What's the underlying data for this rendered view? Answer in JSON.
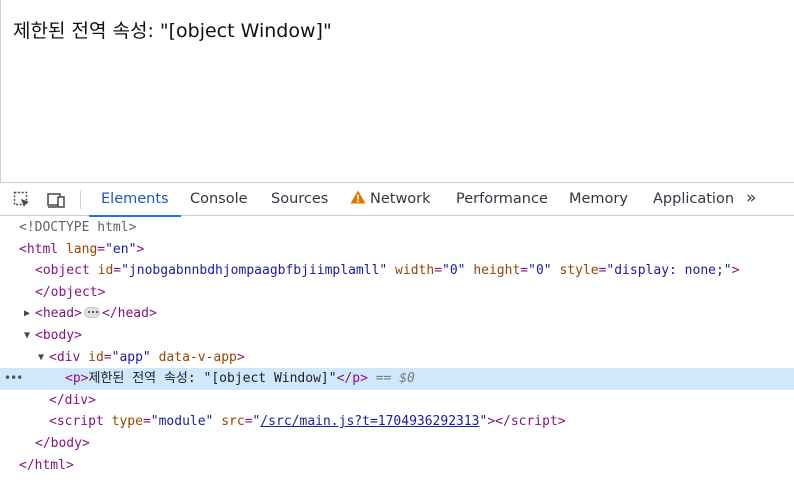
{
  "page": {
    "text": "제한된 전역 속성: \"[object Window]\""
  },
  "devtools": {
    "tabs": [
      {
        "label": "Elements",
        "active": true
      },
      {
        "label": "Console"
      },
      {
        "label": "Sources"
      },
      {
        "label": "Network",
        "warning": true
      },
      {
        "label": "Performance"
      },
      {
        "label": "Memory"
      },
      {
        "label": "Application"
      }
    ],
    "more_tabs": "»",
    "accent_color": "#1a73e8",
    "warning_color": "#e37400"
  },
  "dom": {
    "doctype": "<!DOCTYPE html>",
    "html_tag": "html",
    "html_lang_attr": "lang",
    "html_lang_val": "\"en\"",
    "object_tag": "object",
    "object_id_attr": "id",
    "object_id_val": "\"jnobgabnnbdhjompaagbfbjiimplamll\"",
    "object_width_attr": "width",
    "object_width_val": "\"0\"",
    "object_height_attr": "height",
    "object_height_val": "\"0\"",
    "object_style_attr": "style",
    "object_style_val": "\"display: none;\"",
    "head_tag": "head",
    "body_tag": "body",
    "div_tag": "div",
    "div_id_attr": "id",
    "div_id_val": "\"app\"",
    "div_vapp_attr": "data-v-app",
    "p_tag": "p",
    "p_text": "제한된 전역 속성: \"[object Window]\"",
    "selected_ref": "== $0",
    "script_tag": "script",
    "script_type_attr": "type",
    "script_type_val": "\"module\"",
    "script_src_attr": "src",
    "script_src_val": "/src/main.js?t=1704936292313"
  }
}
